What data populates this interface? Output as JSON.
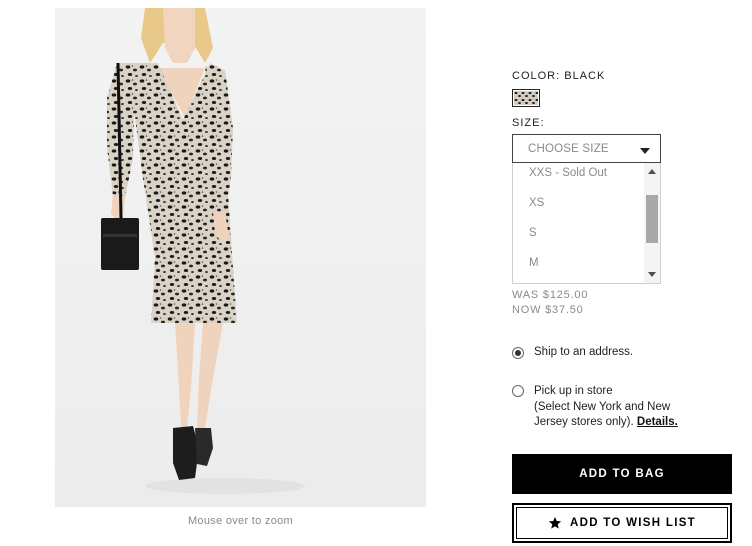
{
  "product": {
    "zoom_hint": "Mouse over to zoom"
  },
  "color": {
    "label": "COLOR: BLACK",
    "swatch_name": "leopard-print-swatch"
  },
  "size": {
    "label": "SIZE:",
    "placeholder": "CHOOSE SIZE",
    "options": [
      "XXS - Sold Out",
      "XS",
      "S",
      "M"
    ]
  },
  "price": {
    "was": "WAS $125.00",
    "now": "NOW $37.50"
  },
  "delivery": {
    "ship_label": "Ship to an address.",
    "pickup_line1": "Pick up in store",
    "pickup_line2": "(Select New York and New Jersey stores only).",
    "details_link": "Details.",
    "selected": "ship"
  },
  "actions": {
    "add_to_bag": "ADD TO BAG",
    "add_to_wishlist": "ADD TO WISH LIST",
    "wishlist_icon": "star-icon"
  },
  "colors": {
    "primary_button": "#000000",
    "muted_text": "#8a8a8a"
  }
}
